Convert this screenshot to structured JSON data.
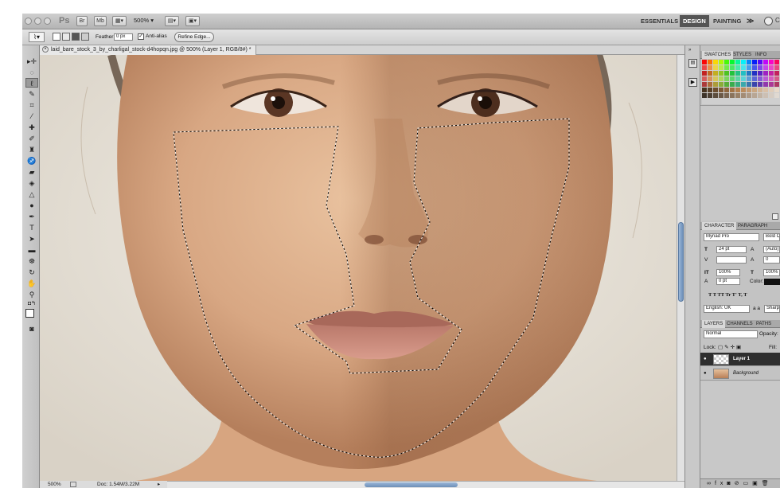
{
  "app": {
    "logo": "Ps",
    "bridge_label": "Br",
    "mini_label": "Mb",
    "zoom": "500%"
  },
  "workspaces": {
    "essentials": "ESSENTIALS",
    "design": "DESIGN",
    "painting": "PAINTING",
    "more": "≫",
    "search": "C"
  },
  "options": {
    "feather_label": "Feather:",
    "feather_value": "0 px",
    "antialias_label": "Anti-alias",
    "refine_edge": "Refine Edge..."
  },
  "document": {
    "tab_title": "laid_bare_stock_3_by_charligal_stock-d4hopqn.jpg @ 500% (Layer 1, RGB/8#) *",
    "status_zoom": "500%",
    "status_doc": "Doc: 1.54M/3.22M"
  },
  "panels": {
    "swatch_tabs": [
      "SWATCHES",
      "STYLES",
      "INFO"
    ],
    "char_tabs": [
      "CHARACTER",
      "PARAGRAPH"
    ],
    "font_family": "Myriad Pro",
    "font_style": "Bold Co",
    "font_size": "24 pt",
    "leading": "(Auto)",
    "tracking": "0",
    "v_scale": "100%",
    "h_scale": "100%",
    "baseline": "0 pt",
    "color_label": "Color:",
    "type_buttons": "T  T  TT  Tr  T'  T,  T",
    "language": "English: UK",
    "aa_label": "a a",
    "aa_value": "Sharp",
    "layer_tabs": [
      "LAYERS",
      "CHANNELS",
      "PATHS"
    ],
    "blend_mode": "Normal",
    "opacity_label": "Opacity:",
    "lock_label": "Lock:",
    "fill_label": "Fill:",
    "layers": [
      "Layer 1",
      "Background"
    ]
  },
  "colors": {
    "accent": "#4a4a4a",
    "skin": "#e2b48e",
    "background": "#ece6db"
  }
}
